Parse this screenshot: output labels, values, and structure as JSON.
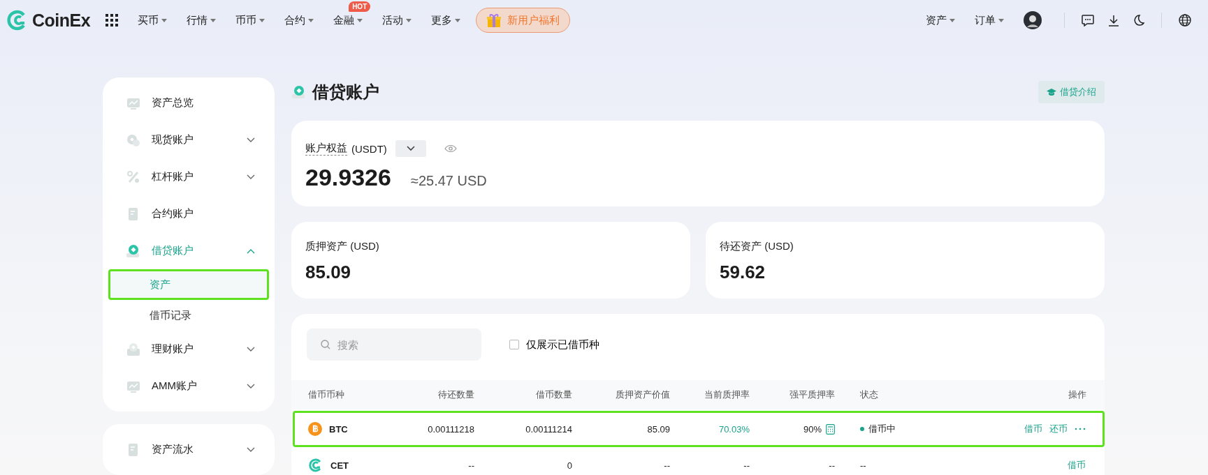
{
  "nav": {
    "logo": "CoinEx",
    "menu": [
      {
        "label": "买币",
        "caret": true
      },
      {
        "label": "行情",
        "caret": true
      },
      {
        "label": "币币",
        "caret": true
      },
      {
        "label": "合约",
        "caret": true
      },
      {
        "label": "金融",
        "caret": true,
        "badge": "HOT"
      },
      {
        "label": "活动",
        "caret": true
      },
      {
        "label": "更多",
        "caret": true
      }
    ],
    "promo": "新用户福利",
    "right_menu": [
      {
        "label": "资产",
        "caret": true
      },
      {
        "label": "订单",
        "caret": true
      }
    ]
  },
  "sidebar": {
    "groups": [
      [
        {
          "label": "资产总览",
          "kind": "chart",
          "selected": false,
          "expandable": false
        },
        {
          "label": "现货账户",
          "kind": "coins",
          "selected": false,
          "expandable": true,
          "expanded": false
        },
        {
          "label": "杠杆账户",
          "kind": "percent",
          "selected": false,
          "expandable": true,
          "expanded": false
        },
        {
          "label": "合约账户",
          "kind": "doc",
          "selected": false,
          "expandable": false
        },
        {
          "label": "借贷账户",
          "kind": "loan",
          "selected": true,
          "expandable": true,
          "expanded": true,
          "children": [
            {
              "label": "资产",
              "selected": true
            },
            {
              "label": "借币记录",
              "selected": false
            }
          ]
        },
        {
          "label": "理财账户",
          "kind": "safe",
          "selected": false,
          "expandable": true,
          "expanded": false
        },
        {
          "label": "AMM账户",
          "kind": "chart",
          "selected": false,
          "expandable": true,
          "expanded": false
        }
      ],
      [
        {
          "label": "资产流水",
          "kind": "doc",
          "selected": false,
          "expandable": true,
          "expanded": false
        }
      ]
    ]
  },
  "page": {
    "title": "借贷账户",
    "intro_button": "借贷介绍"
  },
  "equity": {
    "label": "账户权益",
    "unit": "(USDT)",
    "value": "29.9326",
    "approx": "≈25.47 USD"
  },
  "summary": [
    {
      "label": "质押资产 (USD)",
      "value": "85.09"
    },
    {
      "label": "待还资产 (USD)",
      "value": "59.62"
    }
  ],
  "filters": {
    "search_placeholder": "搜索",
    "only_borrowed": {
      "label": "仅展示已借币种",
      "checked": false
    }
  },
  "table": {
    "columns": [
      "借币币种",
      "待还数量",
      "借币数量",
      "质押资产价值",
      "当前质押率",
      "强平质押率",
      "状态",
      "操作"
    ],
    "rows": [
      {
        "kind": "btc",
        "highlighted": true,
        "cells": [
          "BTC",
          "0.00111218",
          "0.00111214",
          "85.09",
          "70.03%",
          "90%",
          "借币中"
        ],
        "calculator": true,
        "status_dot": true,
        "actions": [
          "借币",
          "还币"
        ],
        "more": true
      },
      {
        "kind": "cet",
        "highlighted": false,
        "cells": [
          "CET",
          "--",
          "0",
          "--",
          "--",
          "--",
          "--"
        ],
        "calculator": false,
        "status_dot": false,
        "actions": [
          "借币"
        ],
        "more": false
      }
    ]
  }
}
